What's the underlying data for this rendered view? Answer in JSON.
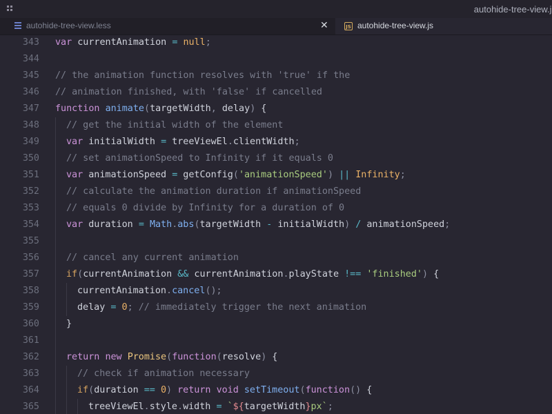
{
  "window": {
    "title": "autohide-tree-view.js"
  },
  "tabs": [
    {
      "label": "autohide-tree-view.less",
      "icon": "less-icon",
      "active": false
    },
    {
      "label": "autohide-tree-view.js",
      "icon": "js-icon",
      "active": true
    }
  ],
  "editor": {
    "colors": {
      "background": "#282631",
      "keyword": "#cc93d9",
      "comment": "#7a7d8c",
      "function": "#7fb0f0",
      "string": "#a9cc7f",
      "number": "#ebb267"
    },
    "lines": [
      {
        "num": "343",
        "indent": 0,
        "tokens": [
          [
            "k",
            "var"
          ],
          [
            "b",
            " currentAnimation "
          ],
          [
            "o",
            "="
          ],
          [
            "b",
            " "
          ],
          [
            "n",
            "null"
          ],
          [
            "p",
            ";"
          ]
        ]
      },
      {
        "num": "344",
        "indent": 0,
        "tokens": []
      },
      {
        "num": "345",
        "indent": 0,
        "tokens": [
          [
            "c",
            "// the animation function resolves with 'true' if the"
          ]
        ]
      },
      {
        "num": "346",
        "indent": 0,
        "tokens": [
          [
            "c",
            "// animation finished, with 'false' if cancelled"
          ]
        ]
      },
      {
        "num": "347",
        "indent": 0,
        "tokens": [
          [
            "k",
            "function"
          ],
          [
            "b",
            " "
          ],
          [
            "f",
            "animate"
          ],
          [
            "p",
            "("
          ],
          [
            "b",
            "targetWidth"
          ],
          [
            "p",
            ", "
          ],
          [
            "b",
            "delay"
          ],
          [
            "p",
            ")"
          ],
          [
            "b",
            " {"
          ]
        ]
      },
      {
        "num": "348",
        "indent": 1,
        "tokens": [
          [
            "c",
            "// get the initial width of the element"
          ]
        ]
      },
      {
        "num": "349",
        "indent": 1,
        "tokens": [
          [
            "k",
            "var"
          ],
          [
            "b",
            " initialWidth "
          ],
          [
            "o",
            "="
          ],
          [
            "b",
            " treeViewEl"
          ],
          [
            "p",
            "."
          ],
          [
            "b",
            "clientWidth"
          ],
          [
            "p",
            ";"
          ]
        ]
      },
      {
        "num": "350",
        "indent": 1,
        "tokens": [
          [
            "c",
            "// set animationSpeed to Infinity if it equals 0"
          ]
        ]
      },
      {
        "num": "351",
        "indent": 1,
        "tokens": [
          [
            "k",
            "var"
          ],
          [
            "b",
            " animationSpeed "
          ],
          [
            "o",
            "="
          ],
          [
            "b",
            " getConfig"
          ],
          [
            "p",
            "("
          ],
          [
            "s",
            "'animationSpeed'"
          ],
          [
            "p",
            ")"
          ],
          [
            "b",
            " "
          ],
          [
            "o",
            "||"
          ],
          [
            "b",
            " "
          ],
          [
            "n",
            "Infinity"
          ],
          [
            "p",
            ";"
          ]
        ]
      },
      {
        "num": "352",
        "indent": 1,
        "tokens": [
          [
            "c",
            "// calculate the animation duration if animationSpeed"
          ]
        ]
      },
      {
        "num": "353",
        "indent": 1,
        "tokens": [
          [
            "c",
            "// equals 0 divide by Infinity for a duration of 0"
          ]
        ]
      },
      {
        "num": "354",
        "indent": 1,
        "tokens": [
          [
            "k",
            "var"
          ],
          [
            "b",
            " duration "
          ],
          [
            "o",
            "="
          ],
          [
            "b",
            " "
          ],
          [
            "f",
            "Math"
          ],
          [
            "p",
            "."
          ],
          [
            "f",
            "abs"
          ],
          [
            "p",
            "("
          ],
          [
            "b",
            "targetWidth "
          ],
          [
            "o",
            "-"
          ],
          [
            "b",
            " initialWidth"
          ],
          [
            "p",
            ")"
          ],
          [
            "b",
            " "
          ],
          [
            "o",
            "/"
          ],
          [
            "b",
            " animationSpeed"
          ],
          [
            "p",
            ";"
          ]
        ]
      },
      {
        "num": "355",
        "indent": 1,
        "tokens": []
      },
      {
        "num": "356",
        "indent": 1,
        "tokens": [
          [
            "c",
            "// cancel any current animation"
          ]
        ]
      },
      {
        "num": "357",
        "indent": 1,
        "tokens": [
          [
            "kn",
            "if"
          ],
          [
            "p",
            "("
          ],
          [
            "b",
            "currentAnimation "
          ],
          [
            "o",
            "&&"
          ],
          [
            "b",
            " currentAnimation"
          ],
          [
            "p",
            "."
          ],
          [
            "b",
            "playState "
          ],
          [
            "o",
            "!=="
          ],
          [
            "b",
            " "
          ],
          [
            "s",
            "'finished'"
          ],
          [
            "p",
            ")"
          ],
          [
            "b",
            " {"
          ]
        ]
      },
      {
        "num": "358",
        "indent": 2,
        "tokens": [
          [
            "b",
            "currentAnimation"
          ],
          [
            "p",
            "."
          ],
          [
            "f",
            "cancel"
          ],
          [
            "p",
            "();"
          ]
        ]
      },
      {
        "num": "359",
        "indent": 2,
        "tokens": [
          [
            "b",
            "delay "
          ],
          [
            "o",
            "="
          ],
          [
            "b",
            " "
          ],
          [
            "n",
            "0"
          ],
          [
            "p",
            ";"
          ],
          [
            "b",
            " "
          ],
          [
            "c",
            "// immediately trigger the next animation"
          ]
        ]
      },
      {
        "num": "360",
        "indent": 1,
        "tokens": [
          [
            "b",
            "}"
          ]
        ]
      },
      {
        "num": "361",
        "indent": 1,
        "tokens": []
      },
      {
        "num": "362",
        "indent": 1,
        "tokens": [
          [
            "k",
            "return"
          ],
          [
            "b",
            " "
          ],
          [
            "k",
            "new"
          ],
          [
            "b",
            " "
          ],
          [
            "cls",
            "Promise"
          ],
          [
            "p",
            "("
          ],
          [
            "k",
            "function"
          ],
          [
            "p",
            "("
          ],
          [
            "b",
            "resolve"
          ],
          [
            "p",
            ")"
          ],
          [
            "b",
            " {"
          ]
        ]
      },
      {
        "num": "363",
        "indent": 2,
        "tokens": [
          [
            "c",
            "// check if animation necessary"
          ]
        ]
      },
      {
        "num": "364",
        "indent": 2,
        "tokens": [
          [
            "kn",
            "if"
          ],
          [
            "p",
            "("
          ],
          [
            "b",
            "duration "
          ],
          [
            "o",
            "=="
          ],
          [
            "b",
            " "
          ],
          [
            "n",
            "0"
          ],
          [
            "p",
            ")"
          ],
          [
            "b",
            " "
          ],
          [
            "k",
            "return"
          ],
          [
            "b",
            " "
          ],
          [
            "k",
            "void"
          ],
          [
            "b",
            " "
          ],
          [
            "f",
            "setTimeout"
          ],
          [
            "p",
            "("
          ],
          [
            "k",
            "function"
          ],
          [
            "p",
            "()"
          ],
          [
            "b",
            " {"
          ]
        ]
      },
      {
        "num": "365",
        "indent": 3,
        "tokens": [
          [
            "b",
            "treeViewEl"
          ],
          [
            "p",
            "."
          ],
          [
            "b",
            "style"
          ],
          [
            "p",
            "."
          ],
          [
            "b",
            "width "
          ],
          [
            "o",
            "="
          ],
          [
            "b",
            " "
          ],
          [
            "s",
            "`"
          ],
          [
            "v",
            "${"
          ],
          [
            "b",
            "targetWidth"
          ],
          [
            "v",
            "}"
          ],
          [
            "s",
            "px`"
          ],
          [
            "p",
            ";"
          ]
        ]
      }
    ]
  }
}
